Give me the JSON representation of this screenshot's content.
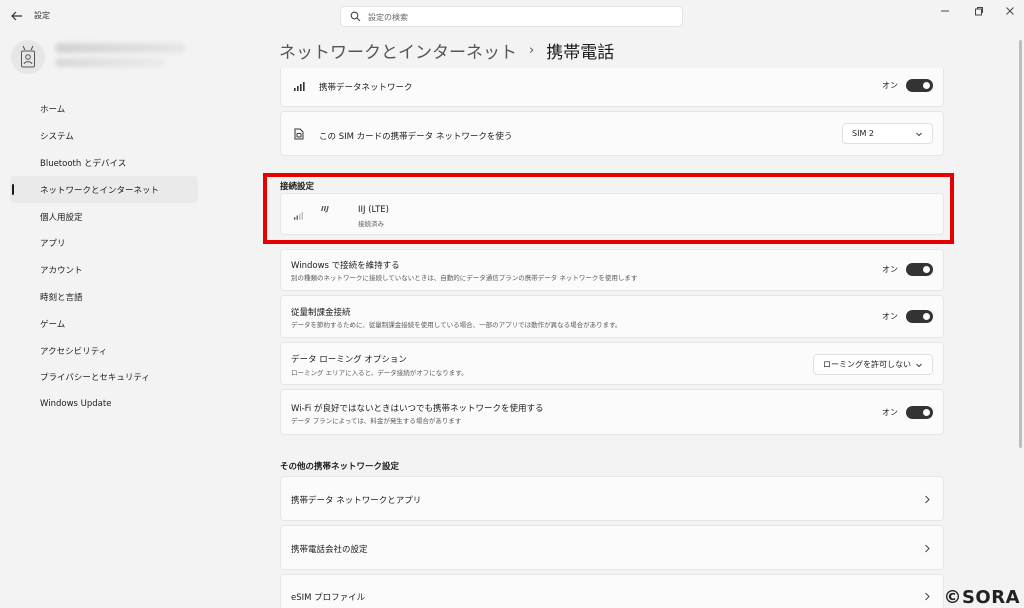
{
  "window": {
    "title": "設定"
  },
  "search": {
    "placeholder": "設定の検索"
  },
  "sidebar": {
    "items": [
      {
        "label": "ホーム"
      },
      {
        "label": "システム"
      },
      {
        "label": "Bluetooth とデバイス"
      },
      {
        "label": "ネットワークとインターネット",
        "active": true
      },
      {
        "label": "個人用設定"
      },
      {
        "label": "アプリ"
      },
      {
        "label": "アカウント"
      },
      {
        "label": "時刻と言語"
      },
      {
        "label": "ゲーム"
      },
      {
        "label": "アクセシビリティ"
      },
      {
        "label": "プライバシーとセキュリティ"
      },
      {
        "label": "Windows Update"
      }
    ]
  },
  "header": {
    "parent": "ネットワークとインターネット",
    "separator": "›",
    "current": "携帯電話"
  },
  "rows": {
    "cellular_data": {
      "title": "携帯データネットワーク",
      "state_label": "オン",
      "on": true
    },
    "sim_select": {
      "title": "この SIM カードの携帯データ ネットワークを使う",
      "value": "SIM 2"
    }
  },
  "connection": {
    "section_label": "接続設定",
    "carrier_logo": "IIJ",
    "name": "IIJ (LTE)",
    "status": "接続済み"
  },
  "settings": {
    "keep_connected": {
      "title": "Windows で接続を維持する",
      "sub": "別の種類のネットワークに接続していないときは、自動的にデータ通信プランの携帯データ ネットワークを使用します",
      "state_label": "オン",
      "on": true
    },
    "metered": {
      "title": "従量制課金接続",
      "sub": "データを節約するために、従量制課金接続を使用している場合、一部のアプリでは動作が異なる場合があります。",
      "state_label": "オン",
      "on": true
    },
    "roaming": {
      "title": "データ ローミング オプション",
      "sub": "ローミング エリアに入ると、データ接続がオフになります。",
      "value": "ローミングを許可しない"
    },
    "wifi_poor": {
      "title": "Wi-Fi が良好ではないときはいつでも携帯ネットワークを使用する",
      "sub": "データ プランによっては、料金が発生する場合があります",
      "state_label": "オン",
      "on": true
    }
  },
  "other": {
    "section_label": "その他の携帯ネットワーク設定",
    "links": [
      {
        "label": "携帯データ ネットワークとアプリ"
      },
      {
        "label": "携帯電話会社の設定"
      },
      {
        "label": "eSIM プロファイル"
      }
    ]
  },
  "watermark": "©SORA"
}
